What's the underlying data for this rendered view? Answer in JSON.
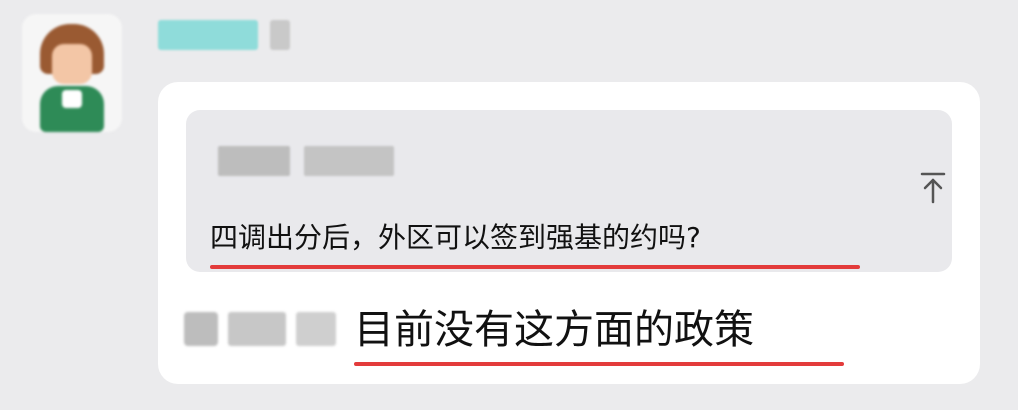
{
  "colors": {
    "background": "#ebebed",
    "bubble": "#ffffff",
    "quote_background": "#e9e9ec",
    "underline": "#e33b3b"
  },
  "chat": {
    "sender": {
      "nickname": "",
      "avatar_icon": "pixelated-avatar"
    },
    "quote": {
      "meta": "",
      "text": "四调出分后，外区可以签到强基的约吗?",
      "pin_icon": "pin-top-icon"
    },
    "reply": {
      "name": "",
      "text": "目前没有这方面的政策"
    }
  }
}
